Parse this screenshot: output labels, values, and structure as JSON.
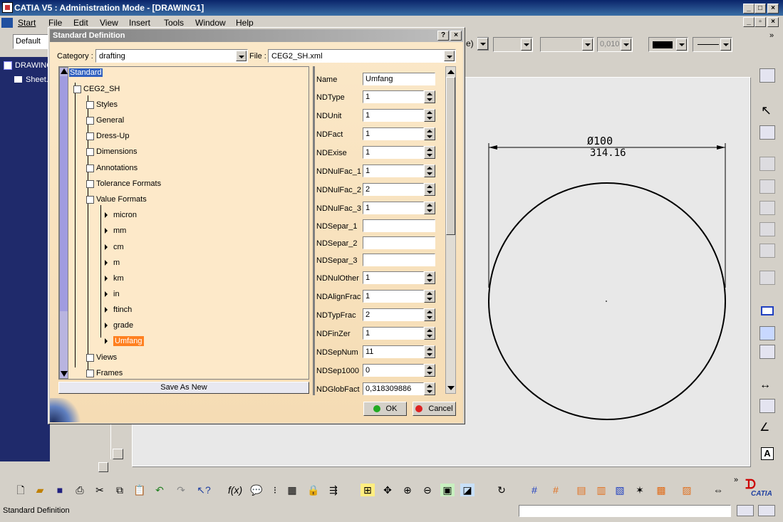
{
  "app": {
    "title": "CATIA V5 : Administration Mode - [DRAWING1]",
    "menu": [
      "Start",
      "File",
      "Edit",
      "View",
      "Insert",
      "Tools",
      "Window",
      "Help"
    ],
    "style_combo": "Default",
    "format_combo": "0,010",
    "partial_text": "e)",
    "brand": "CATIA",
    "status_text": "Standard Definition"
  },
  "spec_tree": {
    "root": "DRAWING",
    "child": "Sheet."
  },
  "drawing": {
    "dim_symbol": "Ø100",
    "dim_value": "314.16"
  },
  "dialog": {
    "title": "Standard Definition",
    "category_label": "Category :",
    "category_value": "drafting",
    "file_label": "File :",
    "file_value": "CEG2_SH.xml",
    "tree": {
      "root": "Standard",
      "standard": "CEG2_SH",
      "groups": [
        "Styles",
        "General",
        "Dress-Up",
        "Dimensions",
        "Annotations",
        "Tolerance Formats",
        "Value Formats"
      ],
      "value_formats": [
        "micron",
        "mm",
        "cm",
        "m",
        "km",
        "in",
        "ftinch",
        "grade",
        "Umfang"
      ],
      "after": [
        "Views",
        "Frames"
      ]
    },
    "save_as_new": "Save As New",
    "params": [
      {
        "label": "Name",
        "value": "Umfang",
        "spin": false
      },
      {
        "label": "NDType",
        "value": "1",
        "spin": true
      },
      {
        "label": "NDUnit",
        "value": "1",
        "spin": true
      },
      {
        "label": "NDFact",
        "value": "1",
        "spin": true
      },
      {
        "label": "NDExise",
        "value": "1",
        "spin": true
      },
      {
        "label": "NDNulFac_1",
        "value": "1",
        "spin": true
      },
      {
        "label": "NDNulFac_2",
        "value": "2",
        "spin": true
      },
      {
        "label": "NDNulFac_3",
        "value": "1",
        "spin": true
      },
      {
        "label": "NDSepar_1",
        "value": "",
        "spin": false
      },
      {
        "label": "NDSepar_2",
        "value": "",
        "spin": false
      },
      {
        "label": "NDSepar_3",
        "value": "",
        "spin": false
      },
      {
        "label": "NDNulOther",
        "value": "1",
        "spin": true
      },
      {
        "label": "NDAlignFrac",
        "value": "1",
        "spin": true
      },
      {
        "label": "NDTypFrac",
        "value": "2",
        "spin": true
      },
      {
        "label": "NDFinZer",
        "value": "1",
        "spin": true
      },
      {
        "label": "NDSepNum",
        "value": "11",
        "spin": true
      },
      {
        "label": "NDSep1000",
        "value": "0",
        "spin": true
      },
      {
        "label": "NDGlobFact",
        "value": "0,318309886",
        "spin": true
      }
    ],
    "ok": "OK",
    "cancel": "Cancel",
    "colors": {
      "ok_dot": "#22aa22",
      "cancel_dot": "#dd2222"
    }
  }
}
